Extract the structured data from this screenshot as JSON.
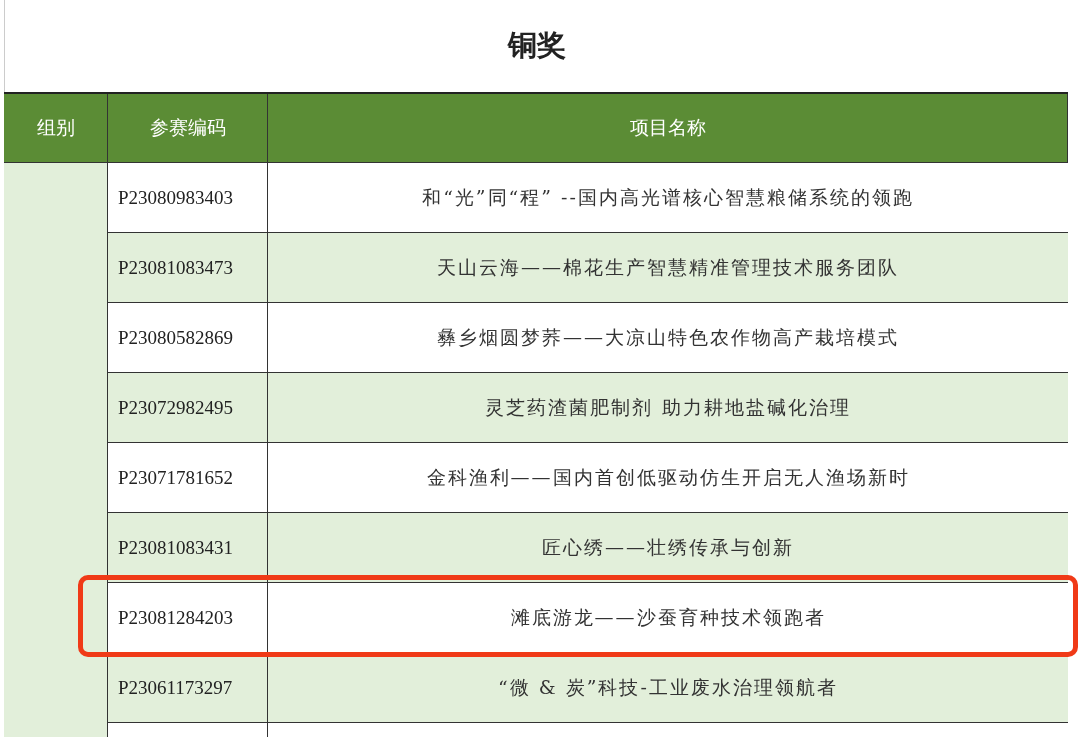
{
  "title": "铜奖",
  "table": {
    "columns": [
      "组别",
      "参赛编码",
      "项目名称"
    ],
    "rows": [
      {
        "code": "P23080983403",
        "name": "和“光”同“程” --国内高光谱核心智慧粮储系统的领跑",
        "highlighted": false
      },
      {
        "code": "P23081083473",
        "name": "天山云海——棉花生产智慧精准管理技术服务团队",
        "highlighted": false
      },
      {
        "code": "P23080582869",
        "name": "彝乡烟圆梦荞——大凉山特色农作物高产栽培模式",
        "highlighted": false
      },
      {
        "code": "P23072982495",
        "name": "灵芝药渣菌肥制剂 助力耕地盐碱化治理",
        "highlighted": false
      },
      {
        "code": "P23071781652",
        "name": "金科渔利——国内首创低驱动仿生开启无人渔场新时",
        "highlighted": false
      },
      {
        "code": "P23081083431",
        "name": "匠心绣——壮绣传承与创新",
        "highlighted": false
      },
      {
        "code": "P23081284203",
        "name": "滩底游龙——沙蚕育种技术领跑者",
        "highlighted": true
      },
      {
        "code": "P23061173297",
        "name": "“微 & 炭”科技-工业废水治理领航者",
        "highlighted": false
      }
    ]
  }
}
